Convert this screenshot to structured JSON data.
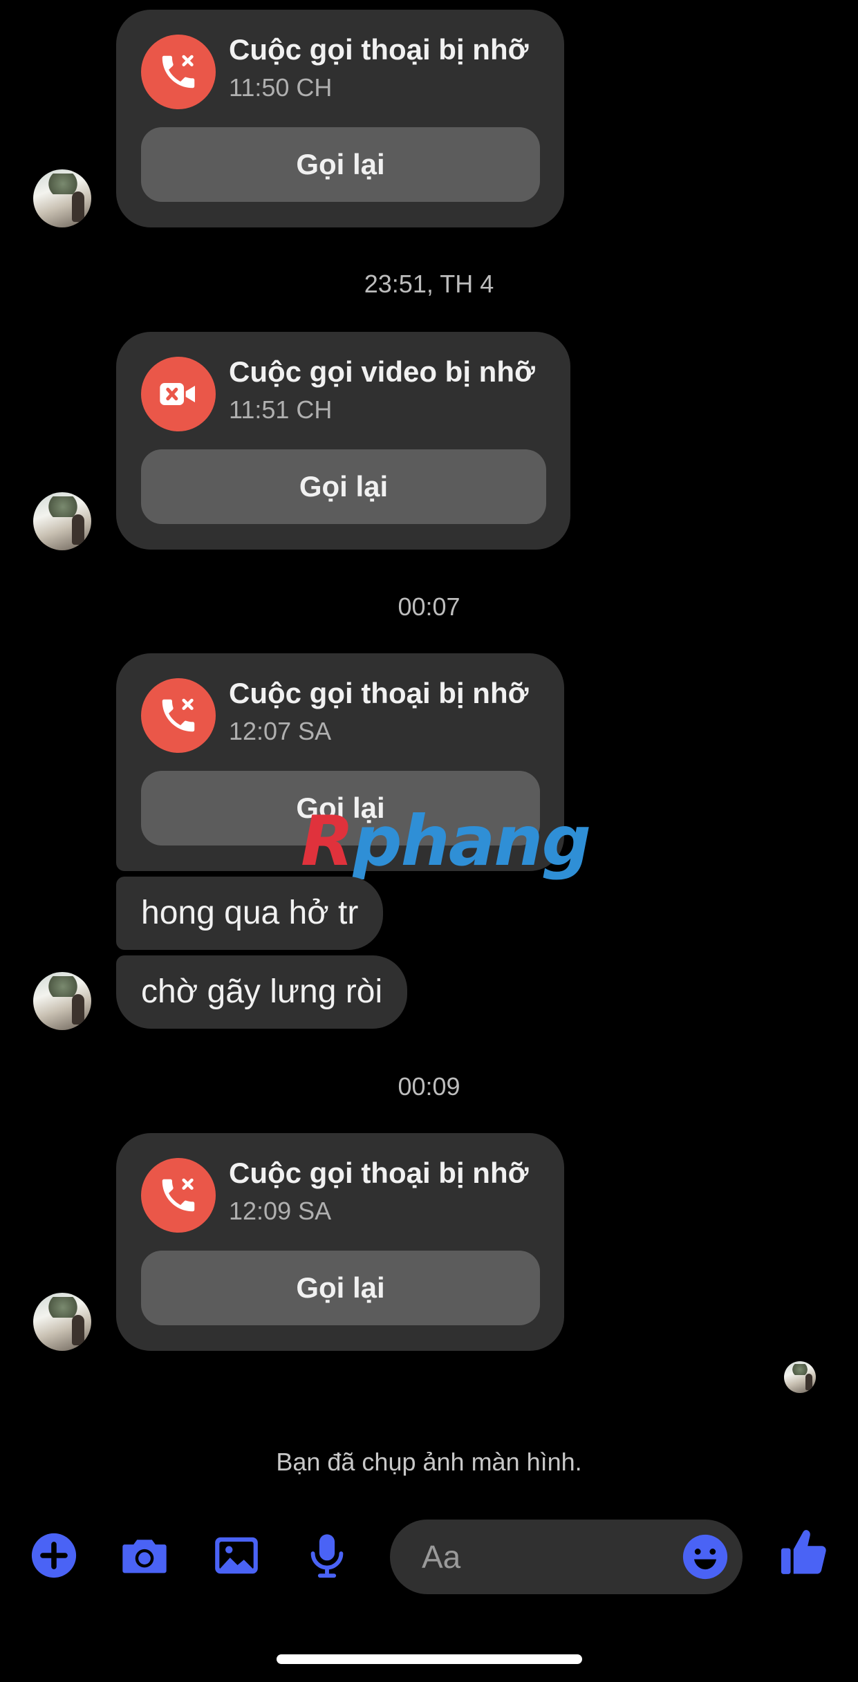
{
  "colors": {
    "accent": "#4a63f5",
    "missed_call": "#ea5749",
    "bubble": "#303030",
    "button": "#5c5c5c",
    "background": "#000000"
  },
  "messages": {
    "call1": {
      "title": "Cuộc gọi thoại bị nhỡ",
      "time": "11:50 CH",
      "button": "Gọi lại",
      "icon": "missed-voice-call-icon"
    },
    "ts1": "23:51, TH 4",
    "call2": {
      "title": "Cuộc gọi video bị nhỡ",
      "time": "11:51 CH",
      "button": "Gọi lại",
      "icon": "missed-video-call-icon"
    },
    "ts2": "00:07",
    "call3": {
      "title": "Cuộc gọi thoại bị nhỡ",
      "time": "12:07 SA",
      "button": "Gọi lại",
      "icon": "missed-voice-call-icon"
    },
    "text1": "hong qua hở tr",
    "text2": "chờ gãy lưng ròi",
    "ts3": "00:09",
    "call4": {
      "title": "Cuộc gọi thoại bị nhỡ",
      "time": "12:09 SA",
      "button": "Gọi lại",
      "icon": "missed-voice-call-icon"
    }
  },
  "watermark": {
    "part1": "R",
    "part2": "phang"
  },
  "screenshot_notice": "Bạn đã chụp ảnh màn hình.",
  "composer": {
    "placeholder": "Aa",
    "tools": [
      "plus-icon",
      "camera-icon",
      "image-icon",
      "microphone-icon",
      "emoji-icon",
      "thumbs-up-icon"
    ]
  }
}
